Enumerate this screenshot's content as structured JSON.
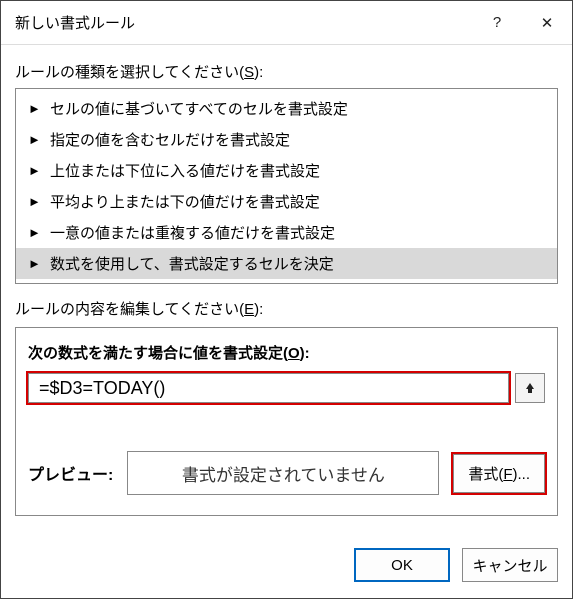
{
  "window": {
    "title": "新しい書式ルール",
    "help_icon": "?",
    "close_icon": "✕"
  },
  "rule_type_label_pre": "ルールの種類を選択してください(",
  "rule_type_label_key": "S",
  "rule_type_label_post": "):",
  "rule_types": [
    "セルの値に基づいてすべてのセルを書式設定",
    "指定の値を含むセルだけを書式設定",
    "上位または下位に入る値だけを書式設定",
    "平均より上または下の値だけを書式設定",
    "一意の値または重複する値だけを書式設定",
    "数式を使用して、書式設定するセルを決定"
  ],
  "selected_rule_index": 5,
  "rule_edit_label_pre": "ルールの内容を編集してください(",
  "rule_edit_label_key": "E",
  "rule_edit_label_post": "):",
  "formula_label_pre": "次の数式を満たす場合に値を書式設定(",
  "formula_label_key": "O",
  "formula_label_post": "):",
  "formula_value": "=$D3=TODAY()",
  "preview_label": "プレビュー:",
  "preview_text": "書式が設定されていません",
  "format_btn_pre": "書式(",
  "format_btn_key": "F",
  "format_btn_post": ")...",
  "ok_label": "OK",
  "cancel_label": "キャンセル"
}
